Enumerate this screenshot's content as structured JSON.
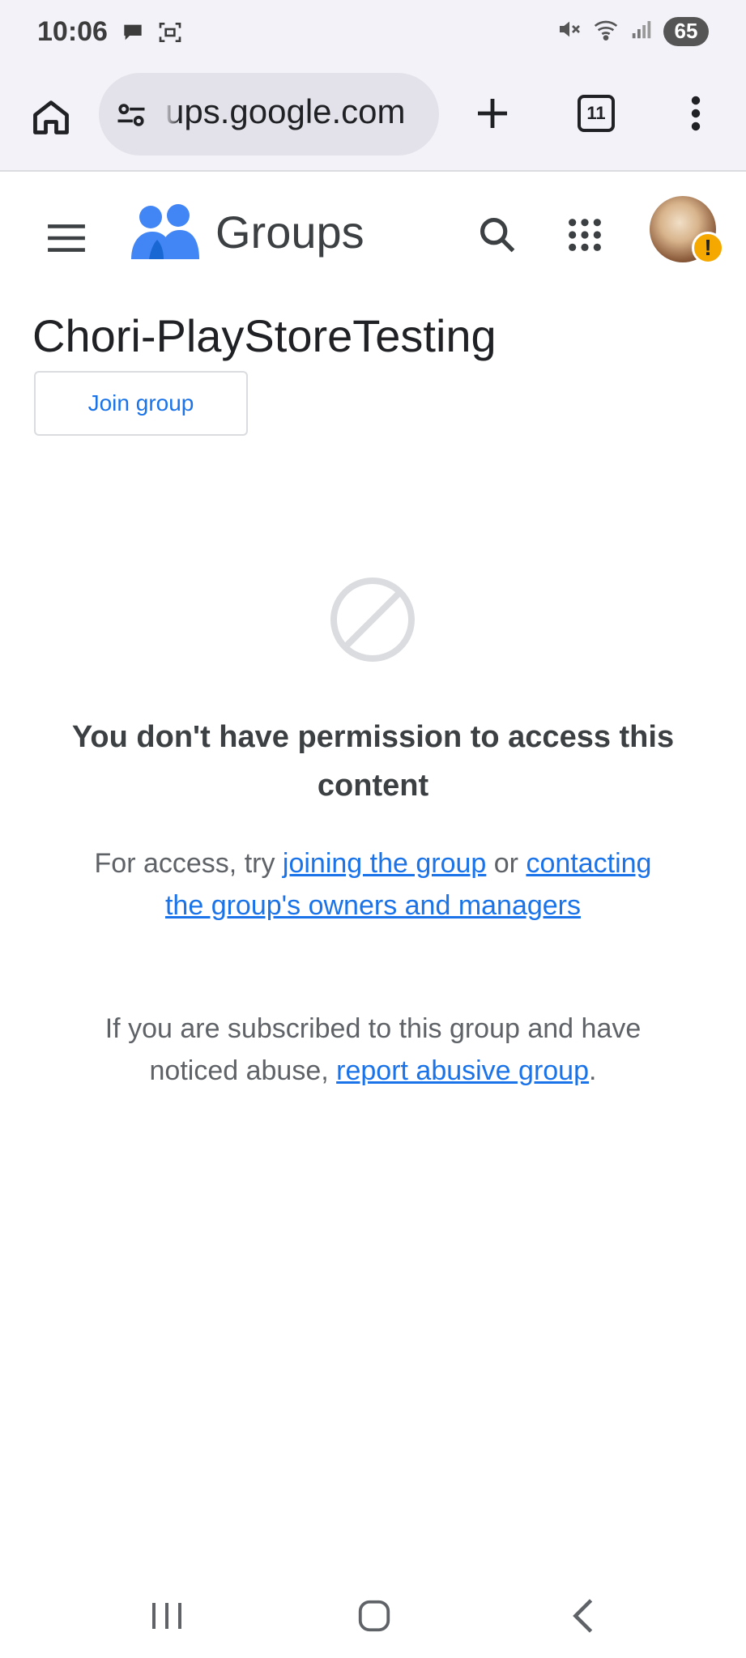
{
  "status_bar": {
    "time": "10:06",
    "battery": "65"
  },
  "browser": {
    "url_display": "ups.google.com",
    "tab_count": "11"
  },
  "app": {
    "brand": "Groups"
  },
  "group": {
    "title": "Chori-PlayStoreTesting",
    "join_label": "Join group"
  },
  "permission": {
    "heading": "You don't have permission to access this content",
    "access_prefix": "For access, try ",
    "joining_link": "joining the group",
    "access_or": " or ",
    "contact_link": "contacting the group's owners and managers",
    "abuse_prefix": "If you are subscribed to this group and have noticed abuse, ",
    "abuse_link": "report abusive group",
    "abuse_suffix": "."
  },
  "colors": {
    "link": "#1a73e8",
    "logo_blue": "#4285f4",
    "warning": "#f5a800"
  }
}
